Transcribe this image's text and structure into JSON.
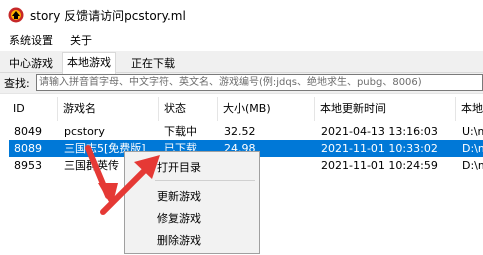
{
  "window": {
    "title": "story 反馈请访问pcstory.ml"
  },
  "menu": {
    "items": [
      "系统设置",
      "关于"
    ]
  },
  "tabs": [
    {
      "label": "中心游戏"
    },
    {
      "label": "本地游戏"
    },
    {
      "label": "正在下载"
    }
  ],
  "search": {
    "label": "查找:",
    "placeholder": "请输入拼音首字母、中文字符、英文名、游戏编号(例:jdqs、绝地求生、pubg、8006)"
  },
  "table": {
    "columns": [
      "ID",
      "游戏名",
      "状态",
      "大小(MB)",
      "本地更新时间",
      "本地"
    ],
    "rows": [
      {
        "id": "8049",
        "name": "pcstory",
        "status": "下载中",
        "size": "32.52",
        "updated": "2021-04-13 13:16:03",
        "path": "U:\\m"
      },
      {
        "id": "8089",
        "name": "三国志5[免费版]",
        "status": "已下载",
        "size": "24.98",
        "updated": "2021-11-01 10:33:02",
        "path": "D:\\m"
      },
      {
        "id": "8953",
        "name": "三国群英传",
        "status": "",
        "size": "",
        "updated": "2021-11-01 10:24:59",
        "path": "D:\\m"
      }
    ]
  },
  "context_menu": {
    "items": [
      "打开目录",
      "更新游戏",
      "修复游戏",
      "删除游戏"
    ]
  },
  "colors": {
    "selection": "#0078d7",
    "annotation_arrow": "#e53935"
  }
}
